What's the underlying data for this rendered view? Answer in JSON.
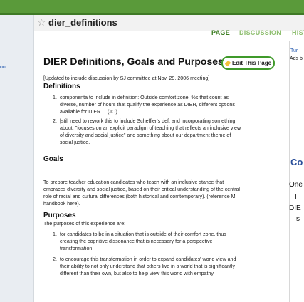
{
  "window": {
    "page_name": "dier_definitions"
  },
  "tabs": {
    "page": "PAGE",
    "discussion": "DISCUSSION",
    "history": "HISTO"
  },
  "left": {
    "link": "on"
  },
  "right": {
    "line1": "Tur",
    "line2": "Ads b",
    "heading": "Co",
    "t1": "One",
    "t2": "I",
    "t3": "DIE",
    "t4": "s"
  },
  "article": {
    "title": "DIER Definitions, Goals and Purposes",
    "edit_label": "Edit This Page",
    "updated_note": "[Updated to include discussion by SJ committee at Nov. 29, 2006 meeting]",
    "definitions_heading": "Definitions",
    "definitions": [
      {
        "num": "1.",
        "lines": [
          "componenta to include in definition: Outside comfort zone, %s that count as",
          "diverse, number of hours that qualify the experience as DIER, different options",
          "available for DIER.... (JO)"
        ]
      },
      {
        "num": "2.",
        "lines": [
          "[still need to rework this to include Scheffler's def, and incorporating something",
          "about, \"focuses on an explicit paradigm of teaching that reflects an inclusive view",
          "of diversity and social justice\" and something about our department theme of",
          "social justice."
        ]
      }
    ],
    "goals_heading": "Goals",
    "goals_lines": [
      "To prepare teacher education candidates who teach with an inclusive stance that",
      "embraces diversity and social justice, based on their critical understanding of the central",
      "role of racial and cultural differences (both historical and comtemporary). (reference MI",
      "handbook here)."
    ],
    "purposes_heading": "Purposes",
    "purposes_intro": "The purposes of this experience are:",
    "purposes": [
      {
        "num": "1.",
        "lines": [
          "for candidates to be in a situation that is outside of their comfort zone, thus",
          "creating the cognitive dissonance that is necessary for a perspective",
          "transformation;"
        ]
      },
      {
        "num": "2.",
        "lines": [
          "to encourage this transformation in order to expand candidates' world view and",
          "their ability to not only understand that others live in a world that is significantly",
          "different than their own, but also to help view this world with empathy,"
        ]
      }
    ]
  }
}
